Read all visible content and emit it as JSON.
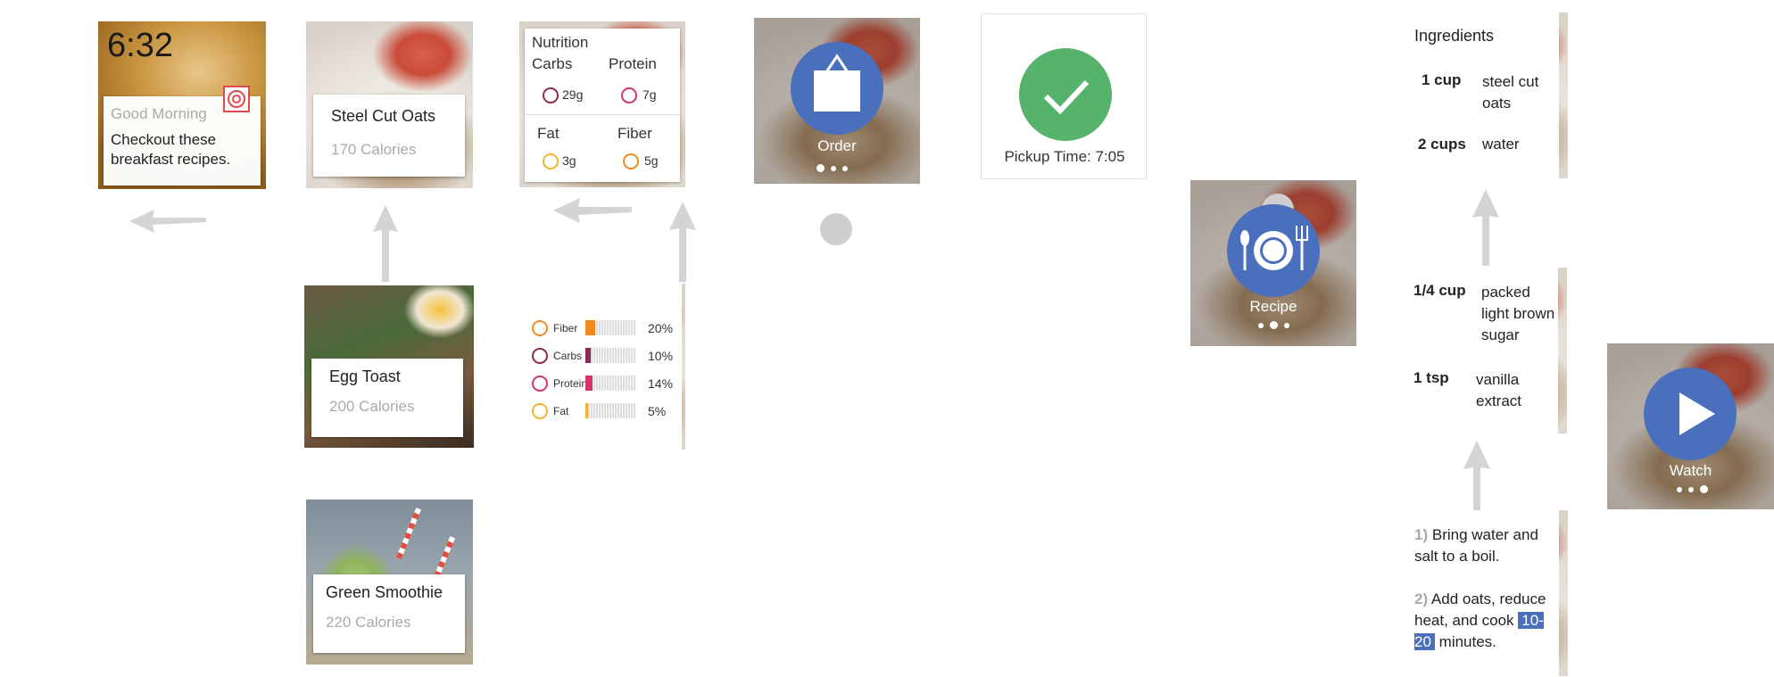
{
  "colors": {
    "accent_blue": "#4a6fbd",
    "check_green": "#56b36b",
    "carbs": "#8b2a55",
    "protein": "#d6336c",
    "fat": "#f2b233",
    "fiber": "#f08a1e",
    "arrow_gray": "#d4d4d4"
  },
  "home": {
    "time": "6:32",
    "greeting": "Good Morning",
    "message": "Checkout these breakfast recipes.",
    "app_icon": "target-icon"
  },
  "recipes": [
    {
      "name": "Steel Cut Oats",
      "calories": "170 Calories"
    },
    {
      "name": "Egg Toast",
      "calories": "200 Calories"
    },
    {
      "name": "Green Smoothie",
      "calories": "220 Calories"
    }
  ],
  "nutrition": {
    "title": "Nutrition",
    "carbs_label": "Carbs",
    "carbs_value": "29g",
    "protein_label": "Protein",
    "protein_value": "7g",
    "fat_label": "Fat",
    "fat_value": "3g",
    "fiber_label": "Fiber",
    "fiber_value": "5g"
  },
  "daily_values": [
    {
      "label": "Fiber",
      "percent": "20%",
      "fraction": 0.2,
      "color": "#f08a1e",
      "icon": "fiber-icon"
    },
    {
      "label": "Carbs",
      "percent": "10%",
      "fraction": 0.1,
      "color": "#8b2a55",
      "icon": "carbs-icon"
    },
    {
      "label": "Protein",
      "percent": "14%",
      "fraction": 0.14,
      "color": "#d6336c",
      "icon": "protein-icon"
    },
    {
      "label": "Fat",
      "percent": "5%",
      "fraction": 0.05,
      "color": "#f2b233",
      "icon": "fat-icon"
    }
  ],
  "actions": {
    "order_label": "Order",
    "order_icon": "shopping-bag-icon",
    "pickup_text": "Pickup Time: 7:05",
    "recipe_label": "Recipe",
    "recipe_icon": "plate-utensils-icon",
    "watch_label": "Watch",
    "watch_icon": "play-icon"
  },
  "ingredients": {
    "title": "Ingredients",
    "items": [
      {
        "qty": "1 cup",
        "name": "steel cut oats"
      },
      {
        "qty": "2 cups",
        "name": "water"
      },
      {
        "qty": "1/4 cup",
        "name": "packed light brown sugar"
      },
      {
        "qty": "1 tsp",
        "name": "vanilla extract"
      }
    ]
  },
  "steps": {
    "step1_num": "1)",
    "step1_text": "Bring water and salt to a boil.",
    "step2_num": "2)",
    "step2_text_a": "Add oats, reduce heat, and cook",
    "step2_time": "10-20",
    "step2_text_b": "minutes."
  }
}
